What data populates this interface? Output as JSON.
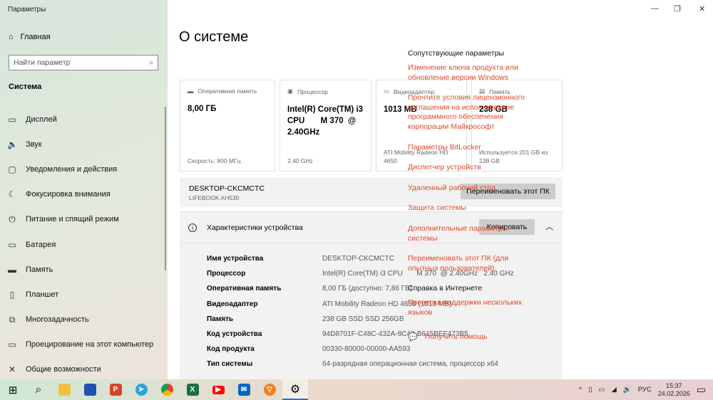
{
  "window": {
    "title": "Параметры",
    "controls": [
      "—",
      "❐",
      "✕"
    ]
  },
  "sidebar": {
    "home": "Главная",
    "search_placeholder": "Найти параметр",
    "section": "Система",
    "items": [
      {
        "icon": "display-icon",
        "glyph": "▭",
        "label": "Дисплей"
      },
      {
        "icon": "sound-icon",
        "glyph": "🔈",
        "label": "Звук"
      },
      {
        "icon": "notifications-icon",
        "glyph": "▢",
        "label": "Уведомления и действия"
      },
      {
        "icon": "focus-icon",
        "glyph": "☾",
        "label": "Фокусировка внимания"
      },
      {
        "icon": "power-icon",
        "glyph": "⏻",
        "label": "Питание и спящий режим"
      },
      {
        "icon": "battery-icon",
        "glyph": "▭",
        "label": "Батарея"
      },
      {
        "icon": "storage-icon",
        "glyph": "▬",
        "label": "Память"
      },
      {
        "icon": "tablet-icon",
        "glyph": "▯",
        "label": "Планшет"
      },
      {
        "icon": "multitasking-icon",
        "glyph": "⧉",
        "label": "Многозадачность"
      },
      {
        "icon": "projecting-icon",
        "glyph": "▭",
        "label": "Проецирование на этот компьютер"
      },
      {
        "icon": "shared-icon",
        "glyph": "✕",
        "label": "Общие возможности"
      }
    ]
  },
  "main": {
    "title": "О системе",
    "cards": [
      {
        "label": "Оперативная память",
        "value": "8,00 ГБ",
        "footer": "Скорость: 800 МГц"
      },
      {
        "label": "Процессор",
        "value": "Intel(R) Core(TM) i3 CPU       M 370  @ 2.40GHz",
        "footer": "2.40 GHz"
      },
      {
        "label": "Видеоадаптер",
        "value": "1013 MB",
        "footer": "ATI Mobility Radeon HD 4650"
      },
      {
        "label": "Память",
        "value": "238 GB",
        "footer": "Используется 201 GB из 238 GB"
      }
    ],
    "pc_name": "DESKTOP-CKCMCTC",
    "pc_model": "LIFEBOOK AH530",
    "rename_button": "Переименовать этот ПК",
    "specs_title": "Характеристики устройства",
    "copy_button": "Копировать",
    "specs": [
      {
        "k": "Имя устройства",
        "v": "DESKTOP-CKCMCTC"
      },
      {
        "k": "Процессор",
        "v": "Intel(R) Core(TM) i3 CPU       M 370  @ 2.40GHz   2.40 GHz"
      },
      {
        "k": "Оперативная память",
        "v": "8,00 ГБ (доступно: 7,86 ГБ)"
      },
      {
        "k": "Видеоадаптер",
        "v": "ATI Mobility Radeon HD 4650 (1013 MB)"
      },
      {
        "k": "Память",
        "v": "238 GB SSD SSD 256GB"
      },
      {
        "k": "Код устройства",
        "v": "94D8701F-C48C-432A-8C42-B615BEF473B5"
      },
      {
        "k": "Код продукта",
        "v": "00330-80000-00000-AA593"
      },
      {
        "k": "Тип системы",
        "v": "64-разрядная операционная система, процессор x64"
      }
    ]
  },
  "right": {
    "related_title": "Сопутствующие параметры",
    "links": [
      "Изменение ключа продукта или обновление версии Windows",
      "Прочтите условия лицензионного соглашения на использование программного обеспечения корпорации Майкрософт",
      "Параметры BitLocker",
      "Диспетчер устройств",
      "Удаленный рабочий стол",
      "Защита системы",
      "Дополнительные параметры системы",
      "Переименовать этот ПК (для опытных пользователей)"
    ],
    "web_title": "Справка в Интернете",
    "web_links": [
      "Проверка поддержки нескольких языков"
    ],
    "help": "Получить помощь"
  },
  "taskbar": {
    "lang": "РУС",
    "time": "15:37",
    "date": "24.02.2026"
  },
  "colors": {
    "accent": "#e0492c"
  }
}
